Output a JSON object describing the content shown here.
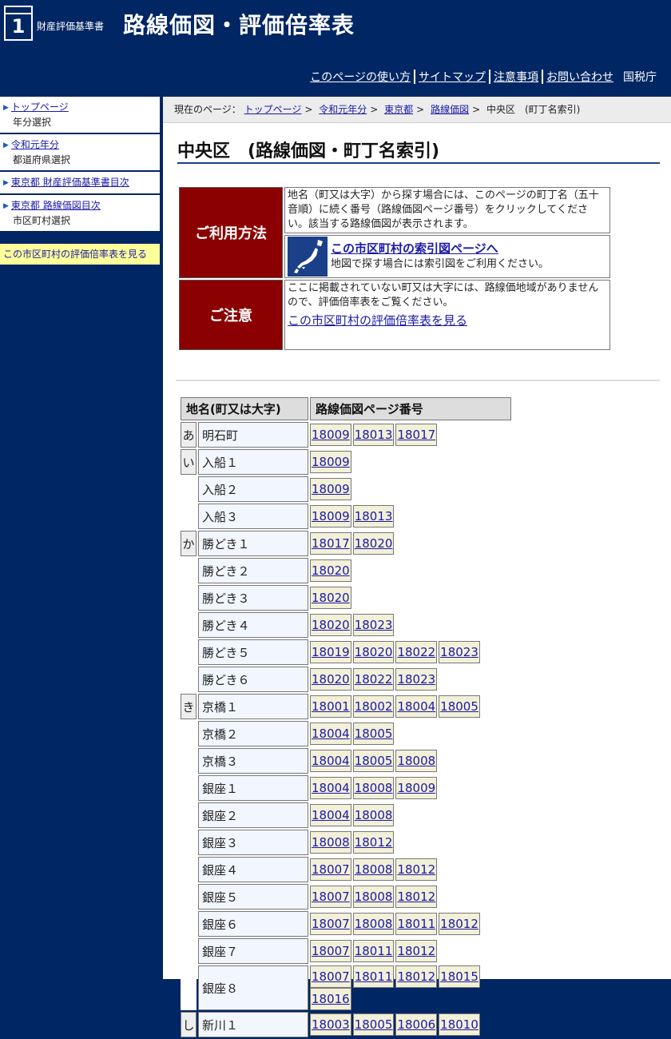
{
  "header": {
    "logo_number": "1",
    "logo_small": "財産評価基準書",
    "logo_big": "路線価図・評価倍率表",
    "links": [
      "このページの使い方",
      "サイトマップ",
      "注意事項",
      "お問い合わせ"
    ],
    "agency": "国税庁"
  },
  "sidebar": {
    "items": [
      {
        "link": "トップページ",
        "sub": "年分選択"
      },
      {
        "link": "令和元年分",
        "sub": "都道府県選択"
      },
      {
        "link": "東京都 財産評価基準書目次",
        "sub": ""
      },
      {
        "link": "東京都 路線価図目次",
        "sub": "市区町村選択"
      }
    ],
    "highlight": "この市区町村の評価倍率表を見る"
  },
  "breadcrumb": {
    "prefix": "現在のページ：",
    "links": [
      "トップページ",
      "令和元年分",
      "東京都",
      "路線価図"
    ],
    "current": "中央区　(町丁名索引)"
  },
  "title": "中央区　(路線価図・町丁名索引)",
  "usage": {
    "label": "ご利用方法",
    "text": "地名（町又は大字）から探す場合には、このページの町丁名（五十音順）に続く番号（路線価図ページ番号）をクリックしてください。該当する路線価図が表示されます。",
    "map_link": "この市区町村の索引図ページへ",
    "map_text": "地図で探す場合には索引図をご利用ください。"
  },
  "caution": {
    "label": "ご注意",
    "text": "ここに掲載されていない町又は大字には、路線価地域がありませんので、評価倍率表をご覧ください。",
    "link": "この市区町村の評価倍率表を見る"
  },
  "table": {
    "headers": [
      "地名(町又は大字)",
      "路線価図ページ番号"
    ],
    "rows": [
      {
        "kana": "あ",
        "name": "明石町",
        "pages": [
          "18009",
          "18013",
          "18017"
        ]
      },
      {
        "kana": "い",
        "name": "入船１",
        "pages": [
          "18009"
        ]
      },
      {
        "kana": "",
        "name": "入船２",
        "pages": [
          "18009"
        ]
      },
      {
        "kana": "",
        "name": "入船３",
        "pages": [
          "18009",
          "18013"
        ]
      },
      {
        "kana": "か",
        "name": "勝どき１",
        "pages": [
          "18017",
          "18020"
        ]
      },
      {
        "kana": "",
        "name": "勝どき２",
        "pages": [
          "18020"
        ]
      },
      {
        "kana": "",
        "name": "勝どき３",
        "pages": [
          "18020"
        ]
      },
      {
        "kana": "",
        "name": "勝どき４",
        "pages": [
          "18020",
          "18023"
        ]
      },
      {
        "kana": "",
        "name": "勝どき５",
        "pages": [
          "18019",
          "18020",
          "18022",
          "18023"
        ]
      },
      {
        "kana": "",
        "name": "勝どき６",
        "pages": [
          "18020",
          "18022",
          "18023"
        ]
      },
      {
        "kana": "き",
        "name": "京橋１",
        "pages": [
          "18001",
          "18002",
          "18004",
          "18005"
        ]
      },
      {
        "kana": "",
        "name": "京橋２",
        "pages": [
          "18004",
          "18005"
        ]
      },
      {
        "kana": "",
        "name": "京橋３",
        "pages": [
          "18004",
          "18005",
          "18008"
        ]
      },
      {
        "kana": "",
        "name": "銀座１",
        "pages": [
          "18004",
          "18008",
          "18009"
        ]
      },
      {
        "kana": "",
        "name": "銀座２",
        "pages": [
          "18004",
          "18008"
        ]
      },
      {
        "kana": "",
        "name": "銀座３",
        "pages": [
          "18008",
          "18012"
        ]
      },
      {
        "kana": "",
        "name": "銀座４",
        "pages": [
          "18007",
          "18008",
          "18012"
        ]
      },
      {
        "kana": "",
        "name": "銀座５",
        "pages": [
          "18007",
          "18008",
          "18012"
        ]
      },
      {
        "kana": "",
        "name": "銀座６",
        "pages": [
          "18007",
          "18008",
          "18011",
          "18012"
        ]
      },
      {
        "kana": "",
        "name": "銀座７",
        "pages": [
          "18007",
          "18011",
          "18012"
        ]
      },
      {
        "kana": "",
        "name": "銀座８",
        "pages": [
          "18007",
          "18011",
          "18012",
          "18015",
          "18016"
        ]
      },
      {
        "kana": "し",
        "name": "新川１",
        "pages": [
          "18003",
          "18005",
          "18006",
          "18010"
        ]
      }
    ]
  }
}
